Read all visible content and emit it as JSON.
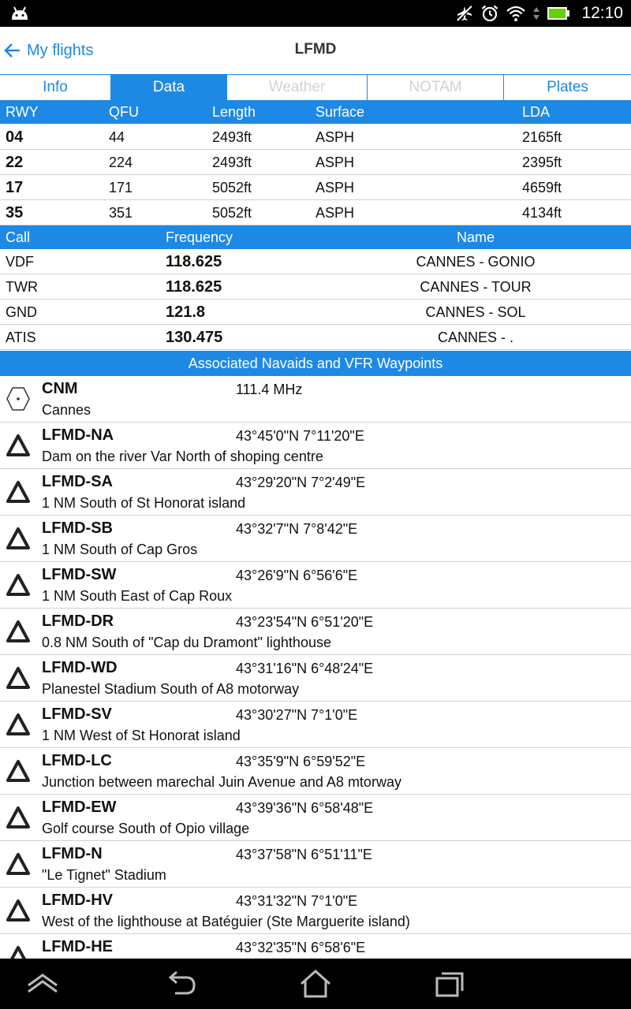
{
  "status_bar": {
    "time": "12:10"
  },
  "action_bar": {
    "back_label": "My flights",
    "title": "LFMD"
  },
  "tabs": [
    {
      "label": "Info",
      "state": "normal"
    },
    {
      "label": "Data",
      "state": "active"
    },
    {
      "label": "Weather",
      "state": "disabled"
    },
    {
      "label": "NOTAM",
      "state": "disabled"
    },
    {
      "label": "Plates",
      "state": "normal"
    }
  ],
  "runways": {
    "headers": [
      "RWY",
      "QFU",
      "Length",
      "Surface",
      "LDA"
    ],
    "rows": [
      [
        "04",
        "44",
        "2493ft",
        "ASPH",
        "2165ft"
      ],
      [
        "22",
        "224",
        "2493ft",
        "ASPH",
        "2395ft"
      ],
      [
        "17",
        "171",
        "5052ft",
        "ASPH",
        "4659ft"
      ],
      [
        "35",
        "351",
        "5052ft",
        "ASPH",
        "4134ft"
      ]
    ]
  },
  "frequencies": {
    "headers": [
      "Call",
      "Frequency",
      "Name"
    ],
    "rows": [
      [
        "VDF",
        "118.625",
        "CANNES - GONIO"
      ],
      [
        "TWR",
        "118.625",
        "CANNES - TOUR"
      ],
      [
        "GND",
        "121.8",
        "CANNES - SOL"
      ],
      [
        "ATIS",
        "130.475",
        "CANNES - ."
      ]
    ]
  },
  "section_title": "Associated Navaids and VFR Waypoints",
  "waypoints": [
    {
      "id": "CNM",
      "info": "111.4 MHz",
      "desc": "Cannes",
      "icon": "vor-icon"
    },
    {
      "id": "LFMD-NA",
      "info": "43°45'0\"N 7°11'20\"E",
      "desc": "Dam on the river Var North of shoping centre",
      "icon": "waypoint-triangle-icon"
    },
    {
      "id": "LFMD-SA",
      "info": "43°29'20\"N 7°2'49\"E",
      "desc": "1 NM South of St Honorat island",
      "icon": "waypoint-triangle-icon"
    },
    {
      "id": "LFMD-SB",
      "info": "43°32'7\"N 7°8'42\"E",
      "desc": "1 NM South of Cap Gros",
      "icon": "waypoint-triangle-icon"
    },
    {
      "id": "LFMD-SW",
      "info": "43°26'9\"N 6°56'6\"E",
      "desc": "1 NM South East of Cap Roux",
      "icon": "waypoint-triangle-icon"
    },
    {
      "id": "LFMD-DR",
      "info": "43°23'54\"N 6°51'20\"E",
      "desc": "0.8 NM South of \"Cap du Dramont\" lighthouse",
      "icon": "waypoint-triangle-icon"
    },
    {
      "id": "LFMD-WD",
      "info": "43°31'16\"N 6°48'24\"E",
      "desc": "Planestel Stadium South of A8 motorway",
      "icon": "waypoint-triangle-icon"
    },
    {
      "id": "LFMD-SV",
      "info": "43°30'27\"N 7°1'0\"E",
      "desc": "1 NM West of St Honorat island",
      "icon": "waypoint-triangle-icon"
    },
    {
      "id": "LFMD-LC",
      "info": "43°35'9\"N 6°59'52\"E",
      "desc": "Junction between marechal Juin Avenue and A8 mtorway",
      "icon": "waypoint-triangle-icon"
    },
    {
      "id": "LFMD-EW",
      "info": "43°39'36\"N 6°58'48\"E",
      "desc": "Golf course South of Opio village",
      "icon": "waypoint-triangle-icon"
    },
    {
      "id": "LFMD-N",
      "info": "43°37'58\"N 6°51'11\"E",
      "desc": "\"Le Tignet\" Stadium",
      "icon": "waypoint-triangle-icon"
    },
    {
      "id": "LFMD-HV",
      "info": "43°31'32\"N 7°1'0\"E",
      "desc": "West of the lighthouse at Batéguier (Ste Marguerite island)",
      "icon": "waypoint-triangle-icon"
    },
    {
      "id": "LFMD-HE",
      "info": "43°32'35\"N 6°58'6\"E",
      "desc": "",
      "icon": "waypoint-triangle-icon"
    }
  ],
  "colors": {
    "accent": "#1e88e5",
    "disabled_tab": "#d2d2d2",
    "battery": "#5fd300"
  }
}
